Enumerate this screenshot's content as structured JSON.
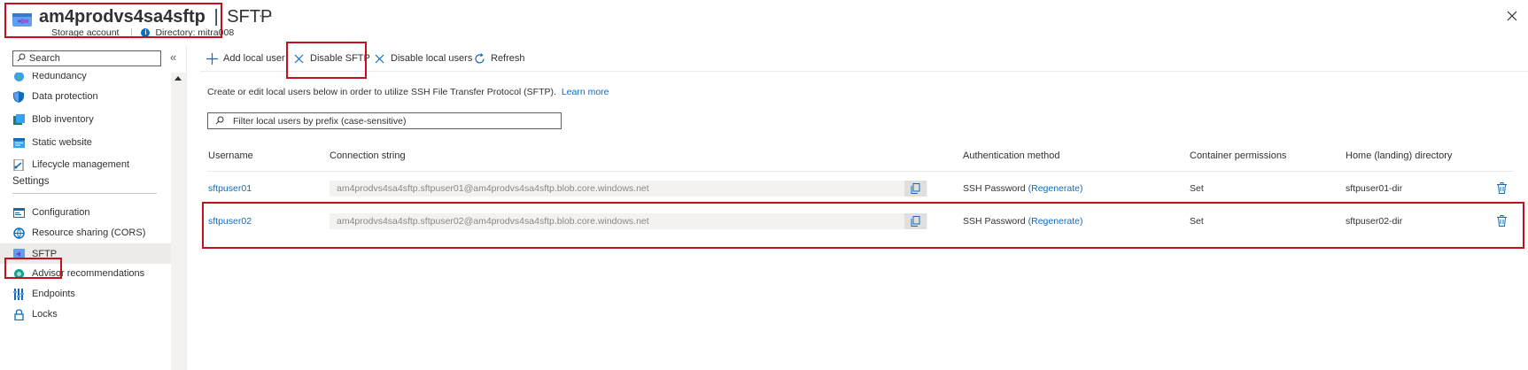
{
  "header": {
    "resource_name": "am4prodvs4sa4sftp",
    "separator": "|",
    "blade_title": "SFTP",
    "resource_type": "Storage account",
    "directory": "Directory: mitra008",
    "more_label": "···"
  },
  "sidebar": {
    "search_placeholder": "Search",
    "collapse_glyph": "«",
    "items_top": [
      {
        "label": "Redundancy",
        "icon": "globe-icon"
      },
      {
        "label": "Data protection",
        "icon": "shield-icon"
      },
      {
        "label": "Blob inventory",
        "icon": "inventory-icon"
      },
      {
        "label": "Static website",
        "icon": "website-icon"
      },
      {
        "label": "Lifecycle management",
        "icon": "lifecycle-icon"
      }
    ],
    "settings_title": "Settings",
    "items_settings": [
      {
        "label": "Configuration",
        "icon": "configuration-icon"
      },
      {
        "label": "Resource sharing (CORS)",
        "icon": "cors-icon"
      },
      {
        "label": "SFTP",
        "icon": "sftp-icon",
        "selected": true
      },
      {
        "label": "Advisor recommendations",
        "icon": "advisor-icon"
      },
      {
        "label": "Endpoints",
        "icon": "endpoints-icon"
      },
      {
        "label": "Locks",
        "icon": "lock-icon"
      }
    ]
  },
  "toolbar": {
    "add_local_user": "Add local user",
    "disable_sftp": "Disable SFTP",
    "disable_local_users": "Disable local users",
    "refresh": "Refresh"
  },
  "content": {
    "description": "Create or edit local users below in order to utilize SSH File Transfer Protocol (SFTP).",
    "learn_more": "Learn more",
    "filter_placeholder": "Filter local users by prefix (case-sensitive)"
  },
  "table": {
    "headers": {
      "username": "Username",
      "connection_string": "Connection string",
      "auth_method": "Authentication method",
      "container_permissions": "Container permissions",
      "home_directory": "Home (landing) directory"
    },
    "rows": [
      {
        "username": "sftpuser01",
        "connection_string": "am4prodvs4sa4sftp.sftpuser01@am4prodvs4sa4sftp.blob.core.windows.net",
        "auth_method": "SSH Password",
        "regenerate": "(Regenerate)",
        "permissions": "Set",
        "home_directory": "sftpuser01-dir"
      },
      {
        "username": "sftpuser02",
        "connection_string": "am4prodvs4sa4sftp.sftpuser02@am4prodvs4sa4sftp.blob.core.windows.net",
        "auth_method": "SSH Password",
        "regenerate": "(Regenerate)",
        "permissions": "Set",
        "home_directory": "sftpuser02-dir"
      }
    ]
  },
  "colors": {
    "accent": "#0f6cbd",
    "highlight": "#c50f1f",
    "selected_nav": "#edebe9"
  }
}
